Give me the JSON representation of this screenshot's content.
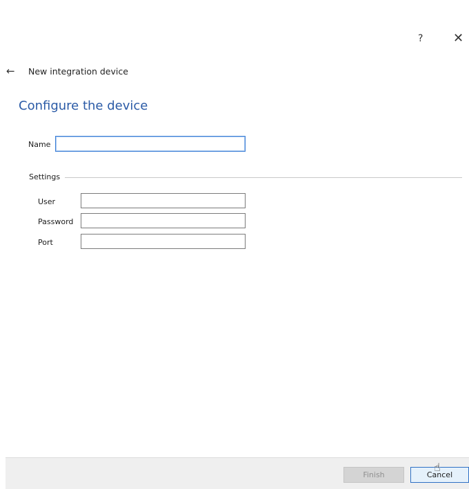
{
  "window": {
    "help_glyph": "?",
    "close_glyph": "✕"
  },
  "header": {
    "back_glyph": "←",
    "title": "New integration device"
  },
  "main": {
    "heading": "Configure the device",
    "name_label": "Name",
    "name_value": "",
    "settings": {
      "title": "Settings",
      "user_label": "User",
      "user_value": "",
      "password_label": "Password",
      "password_value": "",
      "port_label": "Port",
      "port_value": ""
    }
  },
  "footer": {
    "finish_label": "Finish",
    "cancel_label": "Cancel"
  },
  "colors": {
    "heading": "#2a5aa6",
    "focus_border": "#3c7fd6",
    "disabled_button": "#d4d4d4",
    "default_button_border": "#2e6fc4"
  },
  "icons": {
    "help": "help-icon",
    "close": "close-icon",
    "back": "back-arrow-icon",
    "cursor": "hand-pointer-icon"
  }
}
